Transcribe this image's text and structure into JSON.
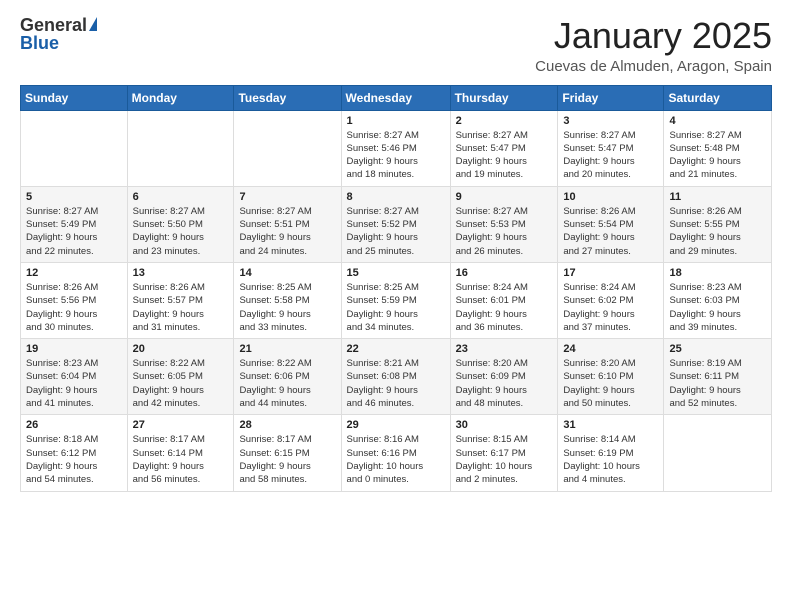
{
  "header": {
    "logo_general": "General",
    "logo_blue": "Blue",
    "month_title": "January 2025",
    "location": "Cuevas de Almuden, Aragon, Spain"
  },
  "days_of_week": [
    "Sunday",
    "Monday",
    "Tuesday",
    "Wednesday",
    "Thursday",
    "Friday",
    "Saturday"
  ],
  "weeks": [
    [
      {
        "day": "",
        "info": ""
      },
      {
        "day": "",
        "info": ""
      },
      {
        "day": "",
        "info": ""
      },
      {
        "day": "1",
        "info": "Sunrise: 8:27 AM\nSunset: 5:46 PM\nDaylight: 9 hours\nand 18 minutes."
      },
      {
        "day": "2",
        "info": "Sunrise: 8:27 AM\nSunset: 5:47 PM\nDaylight: 9 hours\nand 19 minutes."
      },
      {
        "day": "3",
        "info": "Sunrise: 8:27 AM\nSunset: 5:47 PM\nDaylight: 9 hours\nand 20 minutes."
      },
      {
        "day": "4",
        "info": "Sunrise: 8:27 AM\nSunset: 5:48 PM\nDaylight: 9 hours\nand 21 minutes."
      }
    ],
    [
      {
        "day": "5",
        "info": "Sunrise: 8:27 AM\nSunset: 5:49 PM\nDaylight: 9 hours\nand 22 minutes."
      },
      {
        "day": "6",
        "info": "Sunrise: 8:27 AM\nSunset: 5:50 PM\nDaylight: 9 hours\nand 23 minutes."
      },
      {
        "day": "7",
        "info": "Sunrise: 8:27 AM\nSunset: 5:51 PM\nDaylight: 9 hours\nand 24 minutes."
      },
      {
        "day": "8",
        "info": "Sunrise: 8:27 AM\nSunset: 5:52 PM\nDaylight: 9 hours\nand 25 minutes."
      },
      {
        "day": "9",
        "info": "Sunrise: 8:27 AM\nSunset: 5:53 PM\nDaylight: 9 hours\nand 26 minutes."
      },
      {
        "day": "10",
        "info": "Sunrise: 8:26 AM\nSunset: 5:54 PM\nDaylight: 9 hours\nand 27 minutes."
      },
      {
        "day": "11",
        "info": "Sunrise: 8:26 AM\nSunset: 5:55 PM\nDaylight: 9 hours\nand 29 minutes."
      }
    ],
    [
      {
        "day": "12",
        "info": "Sunrise: 8:26 AM\nSunset: 5:56 PM\nDaylight: 9 hours\nand 30 minutes."
      },
      {
        "day": "13",
        "info": "Sunrise: 8:26 AM\nSunset: 5:57 PM\nDaylight: 9 hours\nand 31 minutes."
      },
      {
        "day": "14",
        "info": "Sunrise: 8:25 AM\nSunset: 5:58 PM\nDaylight: 9 hours\nand 33 minutes."
      },
      {
        "day": "15",
        "info": "Sunrise: 8:25 AM\nSunset: 5:59 PM\nDaylight: 9 hours\nand 34 minutes."
      },
      {
        "day": "16",
        "info": "Sunrise: 8:24 AM\nSunset: 6:01 PM\nDaylight: 9 hours\nand 36 minutes."
      },
      {
        "day": "17",
        "info": "Sunrise: 8:24 AM\nSunset: 6:02 PM\nDaylight: 9 hours\nand 37 minutes."
      },
      {
        "day": "18",
        "info": "Sunrise: 8:23 AM\nSunset: 6:03 PM\nDaylight: 9 hours\nand 39 minutes."
      }
    ],
    [
      {
        "day": "19",
        "info": "Sunrise: 8:23 AM\nSunset: 6:04 PM\nDaylight: 9 hours\nand 41 minutes."
      },
      {
        "day": "20",
        "info": "Sunrise: 8:22 AM\nSunset: 6:05 PM\nDaylight: 9 hours\nand 42 minutes."
      },
      {
        "day": "21",
        "info": "Sunrise: 8:22 AM\nSunset: 6:06 PM\nDaylight: 9 hours\nand 44 minutes."
      },
      {
        "day": "22",
        "info": "Sunrise: 8:21 AM\nSunset: 6:08 PM\nDaylight: 9 hours\nand 46 minutes."
      },
      {
        "day": "23",
        "info": "Sunrise: 8:20 AM\nSunset: 6:09 PM\nDaylight: 9 hours\nand 48 minutes."
      },
      {
        "day": "24",
        "info": "Sunrise: 8:20 AM\nSunset: 6:10 PM\nDaylight: 9 hours\nand 50 minutes."
      },
      {
        "day": "25",
        "info": "Sunrise: 8:19 AM\nSunset: 6:11 PM\nDaylight: 9 hours\nand 52 minutes."
      }
    ],
    [
      {
        "day": "26",
        "info": "Sunrise: 8:18 AM\nSunset: 6:12 PM\nDaylight: 9 hours\nand 54 minutes."
      },
      {
        "day": "27",
        "info": "Sunrise: 8:17 AM\nSunset: 6:14 PM\nDaylight: 9 hours\nand 56 minutes."
      },
      {
        "day": "28",
        "info": "Sunrise: 8:17 AM\nSunset: 6:15 PM\nDaylight: 9 hours\nand 58 minutes."
      },
      {
        "day": "29",
        "info": "Sunrise: 8:16 AM\nSunset: 6:16 PM\nDaylight: 10 hours\nand 0 minutes."
      },
      {
        "day": "30",
        "info": "Sunrise: 8:15 AM\nSunset: 6:17 PM\nDaylight: 10 hours\nand 2 minutes."
      },
      {
        "day": "31",
        "info": "Sunrise: 8:14 AM\nSunset: 6:19 PM\nDaylight: 10 hours\nand 4 minutes."
      },
      {
        "day": "",
        "info": ""
      }
    ]
  ]
}
